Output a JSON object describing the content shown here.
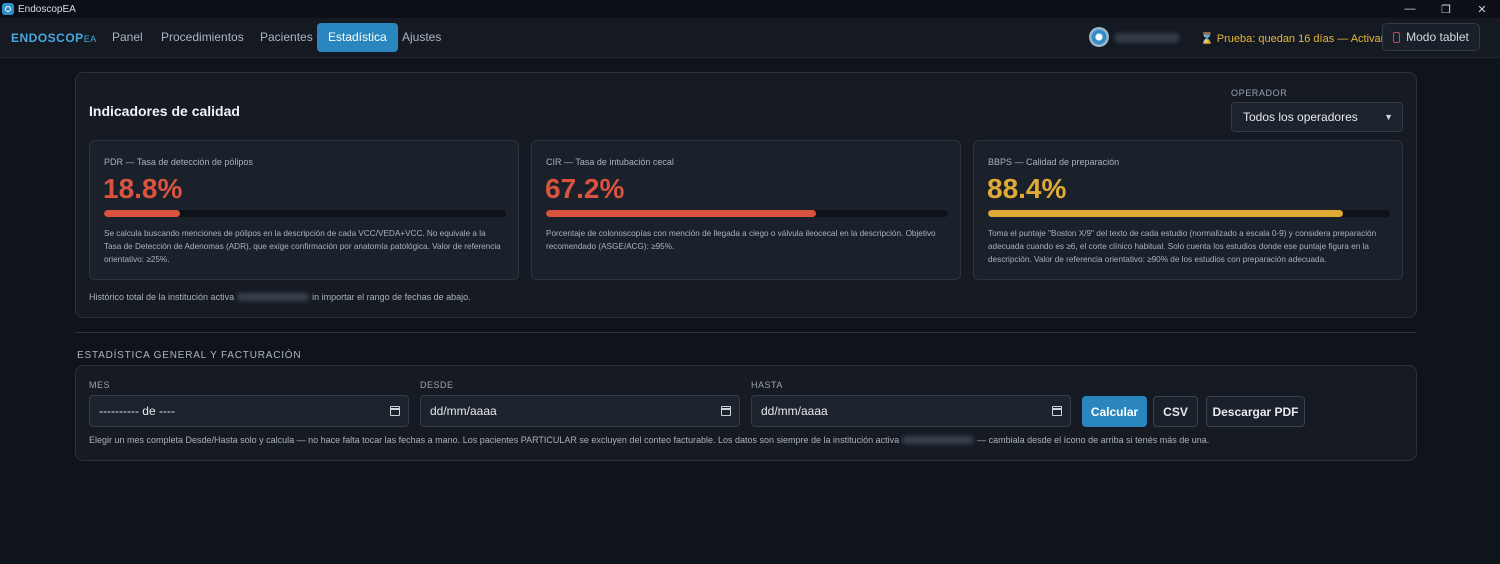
{
  "window": {
    "title": "EndoscopEA",
    "minimize_glyph": "—",
    "restore_glyph": "❐",
    "close_glyph": "✕"
  },
  "nav": {
    "brand_main": "ENDOSCOP",
    "brand_suffix": "EA",
    "items": [
      {
        "label": "Panel"
      },
      {
        "label": "Procedimientos"
      },
      {
        "label": "Pacientes"
      },
      {
        "label": "Estadística",
        "active": true
      },
      {
        "label": "Ajustes"
      }
    ],
    "trial_icon": "⌛",
    "trial_text": "Prueba: quedan 16 días — Activar",
    "tablet_button": "Modo tablet"
  },
  "quality": {
    "title": "Indicadores de calidad",
    "operator_label": "OPERADOR",
    "operator_value": "Todos los operadores",
    "cards": [
      {
        "label": "PDR — Tasa de detección de pólipos",
        "value": "18.8%",
        "progress": 0.188,
        "color": "#d9533f",
        "description": "Se calcula buscando menciones de pólipos en la descripción de cada VCC/VEDA+VCC. No equivale a la Tasa de Detección de Adenomas (ADR), que exige confirmación por anatomía patológica. Valor de referencia orientativo: ≥25%."
      },
      {
        "label": "CIR — Tasa de intubación cecal",
        "value": "67.2%",
        "progress": 0.672,
        "color": "#d9533f",
        "description": "Porcentaje de colonoscopías con mención de llegada a ciego o válvula ileocecal en la descripción. Objetivo recomendado (ASGE/ACG): ≥95%."
      },
      {
        "label": "BBPS — Calidad de preparación",
        "value": "88.4%",
        "progress": 0.884,
        "color": "#e0ab35",
        "description": "Toma el puntaje \"Boston X/9\" del texto de cada estudio (normalizado a escala 0-9) y considera preparación adecuada cuando es ≥6, el corte clínico habitual. Solo cuenta los estudios donde ese puntaje figura en la descripción. Valor de referencia orientativo: ≥90% de los estudios con preparación adecuada."
      }
    ],
    "footer_before": "Histórico total de la institución activa",
    "footer_after": "in importar el rango de fechas de abajo."
  },
  "stats": {
    "section_title": "ESTADÍSTICA GENERAL Y FACTURACIÓN",
    "mes_label": "MES",
    "mes_value": "---------- de ----",
    "desde_label": "DESDE",
    "desde_value": "dd/mm/aaaa",
    "hasta_label": "HASTA",
    "hasta_value": "dd/mm/aaaa",
    "calc_button": "Calcular",
    "csv_button": "CSV",
    "pdf_button": "Descargar PDF",
    "note_before": "Elegir un mes completa Desde/Hasta solo y calcula — no hace falta tocar las fechas a mano. Los pacientes PARTICULAR se excluyen del conteo facturable. Los datos son siempre de la institución activa",
    "note_after": "— cambiala desde el ícono de arriba si tenés más de una."
  }
}
